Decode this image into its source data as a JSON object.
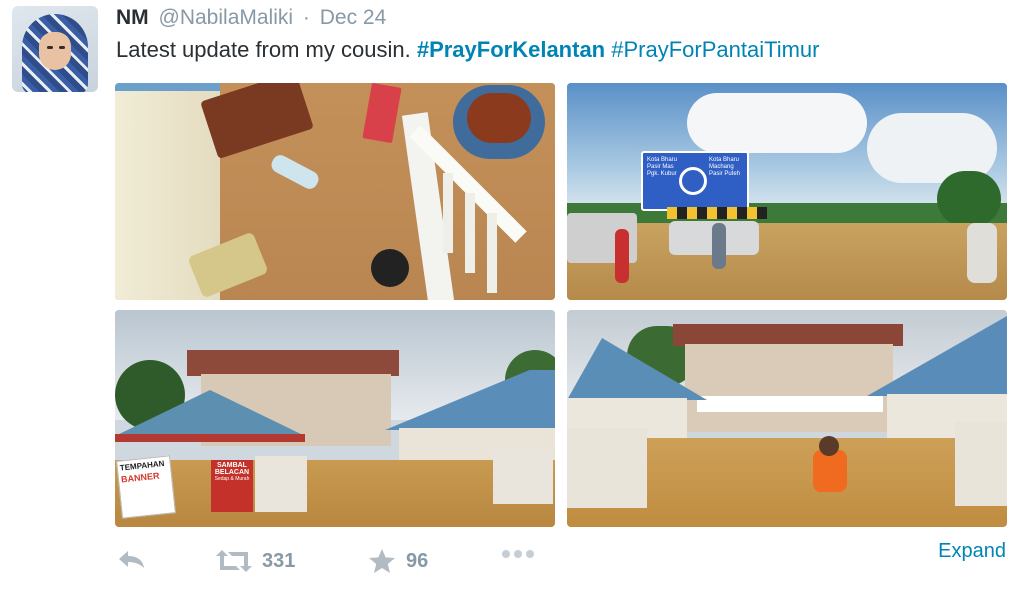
{
  "tweet": {
    "name": "NM",
    "handle": "@NabilaMaliki",
    "separator": "·",
    "date": "Dec 24",
    "text_plain": "Latest update from my cousin.",
    "hashtag1": "#PrayForKelantan",
    "hashtag2": "#PrayForPantaiTimur",
    "avatar_icon": "profile-photo"
  },
  "photos": {
    "road_sign": [
      "Kota Bharu",
      "Pasir Mas",
      "Pgk. Kubur",
      "Kota Bharu",
      "Machang",
      "Pasir Puteh"
    ],
    "shop_sign_1": "TEMPAHAN",
    "shop_sign_1b": "BANNER",
    "shop_sign_2": "SAMBAL",
    "shop_sign_2b": "BELACAN",
    "shop_sign_2c": "Sedap & Murah"
  },
  "actions": {
    "reply_icon": "reply-icon",
    "retweet_icon": "retweet-icon",
    "retweet_count": "331",
    "favorite_icon": "star-icon",
    "favorite_count": "96",
    "more_icon": "more-dots-icon",
    "expand_label": "Expand"
  },
  "colors": {
    "link": "#0084b4",
    "muted": "#8899a6",
    "text": "#292f33",
    "icon": "#b1bbc3"
  }
}
